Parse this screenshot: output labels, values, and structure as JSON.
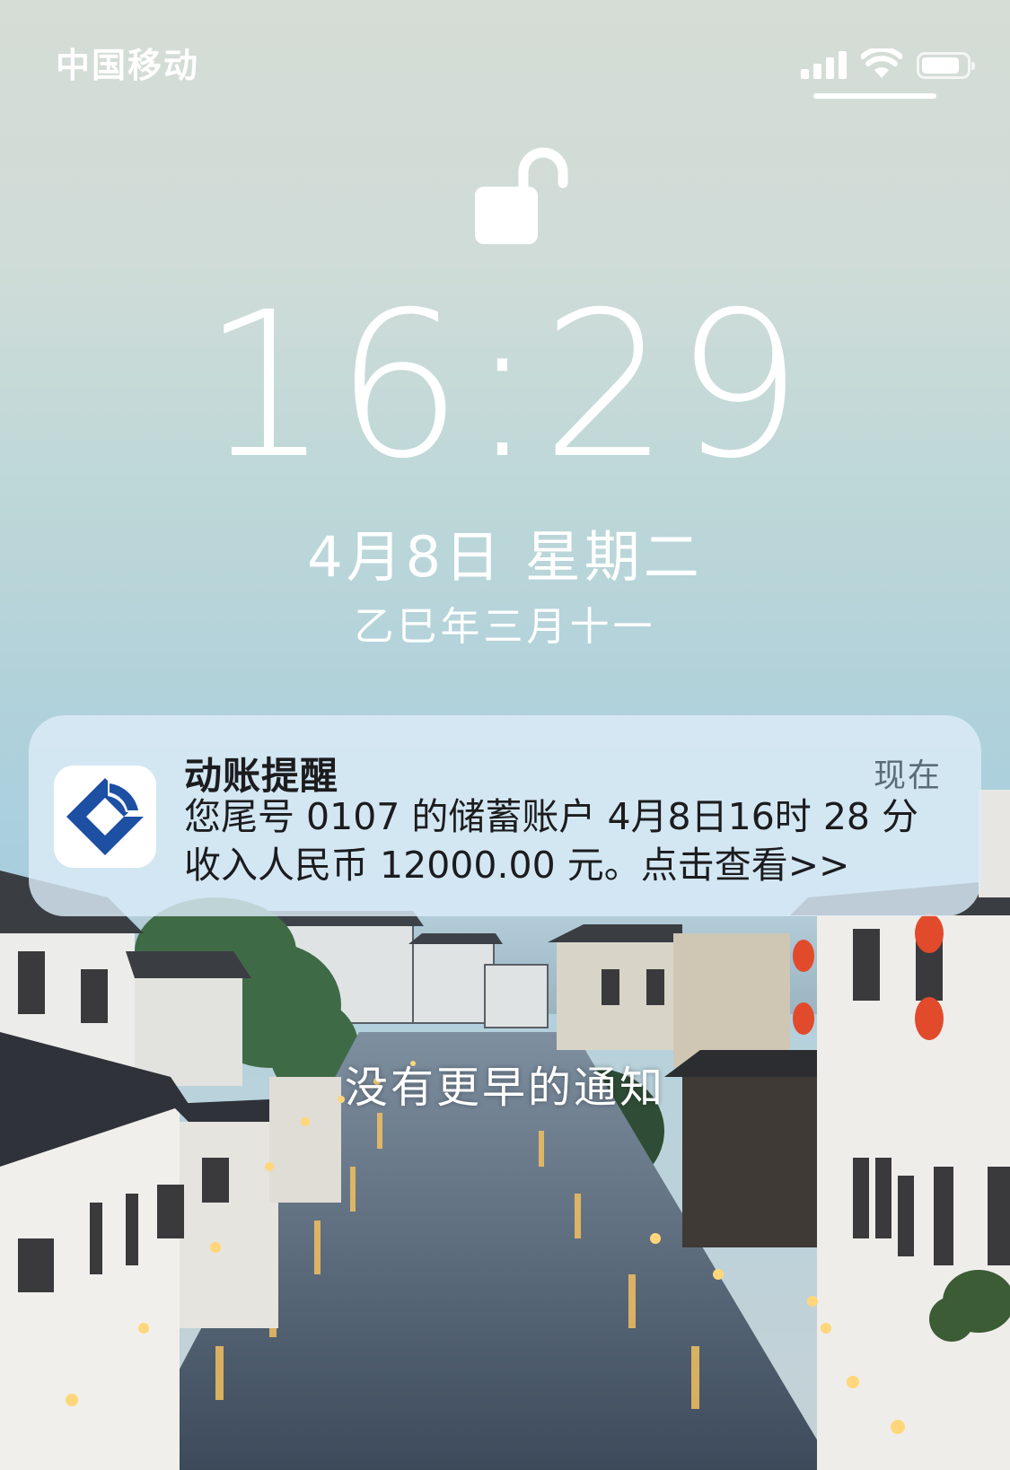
{
  "status_bar": {
    "carrier": "中国移动",
    "signal_icon": "cellular-signal-icon",
    "wifi_icon": "wifi-icon",
    "battery_icon": "battery-icon",
    "battery_level": 0.85
  },
  "lock_screen": {
    "lock_icon": "unlocked-padlock-icon",
    "time": "16:29",
    "date": "4月8日 星期二",
    "lunar_date": "乙巳年三月十一"
  },
  "notification": {
    "app_icon": "ccb-bank-icon",
    "title": "动账提醒",
    "time": "现在",
    "body": "您尾号 0107 的储蓄账户 4月8日16时 28 分收入人民币 12000.00 元。点击查看>>"
  },
  "footer": {
    "no_earlier_notifications": "没有更早的通知"
  },
  "colors": {
    "sky_top": "#d6dcd6",
    "sky_mid": "#a9cfdf",
    "notification_bg": "#dcecf8",
    "ccb_blue": "#1d4fa3"
  }
}
